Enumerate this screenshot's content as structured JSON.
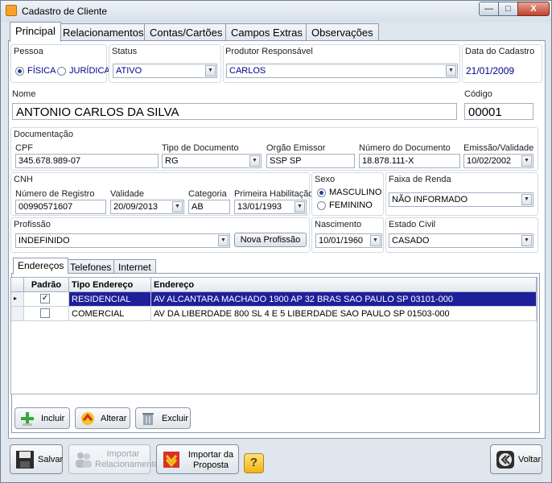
{
  "window": {
    "title": "Cadastro de Cliente",
    "min": "—",
    "max": "□",
    "close": "X"
  },
  "tabs": [
    "Principal",
    "Relacionamentos",
    "Contas/Cartões",
    "Campos Extras",
    "Observações"
  ],
  "pessoa": {
    "label": "Pessoa",
    "fisica": "FÍSICA",
    "juridica": "JURÍDICA"
  },
  "status": {
    "label": "Status",
    "value": "ATIVO"
  },
  "produtor": {
    "label": "Produtor Responsável",
    "value": "CARLOS"
  },
  "data_cadastro": {
    "label": "Data do Cadastro",
    "value": "21/01/2009"
  },
  "nome": {
    "label": "Nome",
    "value": "ANTONIO CARLOS DA SILVA"
  },
  "codigo": {
    "label": "Código",
    "value": "00001"
  },
  "documentacao": {
    "label": "Documentação",
    "cpf_label": "CPF",
    "cpf": "345.678.989-07",
    "tipo_label": "Tipo de Documento",
    "tipo": "RG",
    "orgao_label": "Orgão Emissor",
    "orgao": "SSP SP",
    "numero_label": "Número do Documento",
    "numero": "18.878.111-X",
    "emissao_label": "Emissão/Validade",
    "emissao": "10/02/2002"
  },
  "cnh": {
    "label": "CNH",
    "registro_label": "Número de Registro",
    "registro": "00990571607",
    "validade_label": "Validade",
    "validade": "20/09/2013",
    "categoria_label": "Categoria",
    "categoria": "AB",
    "habilitacao_label": "Primeira Habilitação",
    "habilitacao": "13/01/1993"
  },
  "sexo": {
    "label": "Sexo",
    "masculino": "MASCULINO",
    "feminino": "FEMININO"
  },
  "renda": {
    "label": "Faixa de Renda",
    "value": "NÃO INFORMADO"
  },
  "profissao": {
    "label": "Profissão",
    "value": "INDEFINIDO",
    "nova_button": "Nova Profissão"
  },
  "nascimento": {
    "label": "Nascimento",
    "value": "10/01/1960"
  },
  "estado_civil": {
    "label": "Estado Civil",
    "value": "CASADO"
  },
  "subtabs": [
    "Endereços",
    "Telefones",
    "Internet"
  ],
  "grid": {
    "headers": [
      "Padrão",
      "Tipo Endereço",
      "Endereço"
    ],
    "rows": [
      {
        "tipo": "RESIDENCIAL",
        "endereco": "AV ALCANTARA MACHADO 1900 AP 32 BRAS SAO PAULO SP 03101-000",
        "padrao": "✓"
      },
      {
        "tipo": "COMERCIAL",
        "endereco": "AV DA LIBERDADE 800 SL 4 E 5 LIBERDADE SAO PAULO SP 01503-000",
        "padrao": ""
      }
    ],
    "row_marker": "▸"
  },
  "actions": {
    "incluir": "Incluir",
    "alterar": "Alterar",
    "excluir": "Excluir"
  },
  "bottom": {
    "salvar": "Salvar",
    "importar_rel_1": "Importar",
    "importar_rel_2": "Relacionamento",
    "importar_prop_1": "Importar da",
    "importar_prop_2": "Proposta",
    "help": "?",
    "voltar": "Voltar"
  },
  "colors": {
    "accent_blue": "#00008b",
    "selection": "#1f1f9a"
  }
}
